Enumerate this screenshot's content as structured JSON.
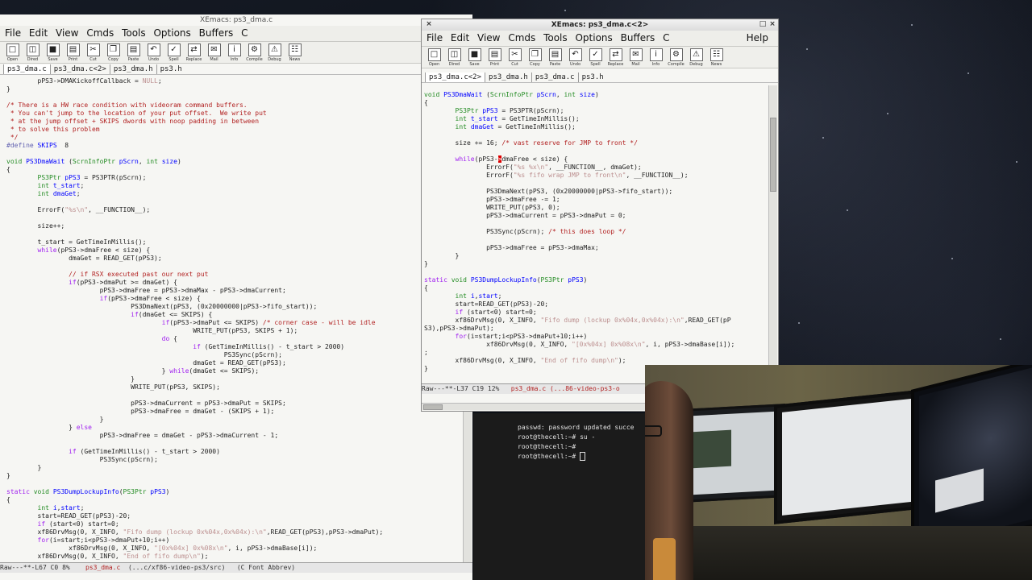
{
  "left_window": {
    "title": "XEmacs: ps3_dma.c",
    "menu": [
      "File",
      "Edit",
      "View",
      "Cmds",
      "Tools",
      "Options",
      "Buffers",
      "C"
    ],
    "toolbar": [
      "Open",
      "Dired",
      "Save",
      "Print",
      "Cut",
      "Copy",
      "Paste",
      "Undo",
      "Spell",
      "Replace",
      "Mail",
      "Info",
      "Compile",
      "Debug",
      "News"
    ],
    "tabs": [
      "ps3_dma.c",
      "ps3_dma.c<2>",
      "ps3_dma.h",
      "ps3.h"
    ],
    "modeline": {
      "prefix": "Raw---**-L67  C0  8%",
      "buffer": "ps3_dma.c",
      "path": "(...c/xf86-video-ps3/src)",
      "mode": "(C Font Abbrev)"
    }
  },
  "right_window": {
    "title": "XEmacs: ps3_dma.c<2>",
    "menu": [
      "File",
      "Edit",
      "View",
      "Cmds",
      "Tools",
      "Options",
      "Buffers",
      "C"
    ],
    "help": "Help",
    "toolbar": [
      "Open",
      "Dired",
      "Save",
      "Print",
      "Cut",
      "Copy",
      "Paste",
      "Undo",
      "Spell",
      "Replace",
      "Mail",
      "Info",
      "Compile",
      "Debug",
      "News"
    ],
    "tabs": [
      "ps3_dma.c<2>",
      "ps3_dma.h",
      "ps3_dma.c",
      "ps3.h"
    ],
    "modeline": {
      "prefix": "Raw---**-L37  C19 12%",
      "buffer": "ps3_dma.c",
      "path": "(...86-video-ps3-o"
    }
  },
  "terminal": {
    "lines": [
      "passwd: password updated succe",
      "root@thecell:~# su -",
      "root@thecell:~#",
      "root@thecell:~# "
    ]
  }
}
